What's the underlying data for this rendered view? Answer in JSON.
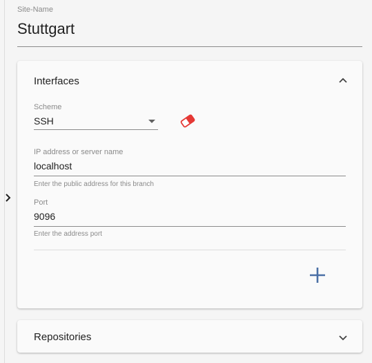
{
  "site": {
    "label": "Site-Name",
    "value": "Stuttgart"
  },
  "interfaces": {
    "title": "Interfaces",
    "scheme": {
      "label": "Scheme",
      "value": "SSH"
    },
    "address": {
      "label": "IP address or server name",
      "value": "localhost",
      "hint": "Enter the public address for this branch"
    },
    "port": {
      "label": "Port",
      "value": "9096",
      "hint": "Enter the address port"
    }
  },
  "repositories": {
    "title": "Repositories"
  },
  "icons": {
    "drawer_toggle": "chevron-right-icon",
    "collapse": "chevron-up-icon",
    "expand": "chevron-down-icon",
    "clear": "eraser-icon",
    "add": "plus-icon"
  },
  "colors": {
    "accent": "#4a6fa5",
    "danger": "#e53935",
    "muted": "#8a8a8a"
  }
}
